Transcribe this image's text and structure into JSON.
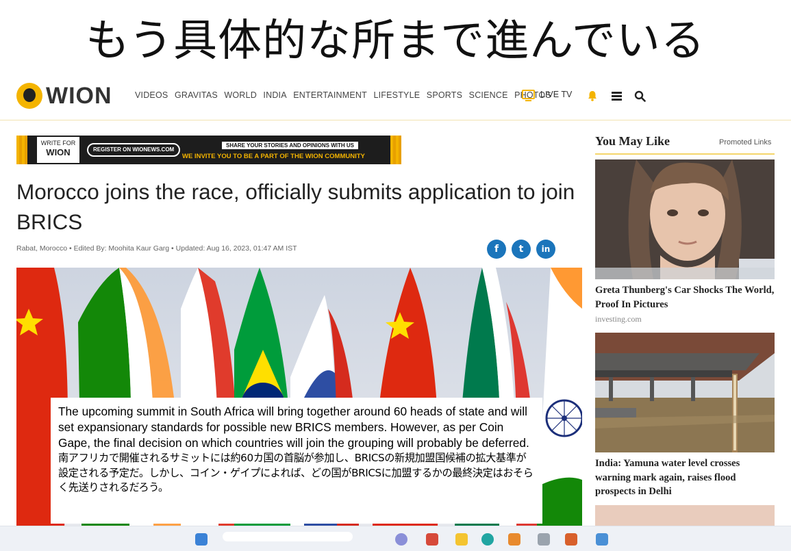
{
  "slide": {
    "title": "もう具体的な所まで進んでいる"
  },
  "header": {
    "logo_text": "WION",
    "nav": [
      "VIDEOS",
      "GRAVITAS",
      "WORLD",
      "INDIA",
      "ENTERTAINMENT",
      "LIFESTYLE",
      "SPORTS",
      "SCIENCE",
      "PHOTOS"
    ],
    "live_tv": "LIVE TV",
    "accent": "#f4b400"
  },
  "banner": {
    "write_for": "WRITE FOR",
    "wion": "WION",
    "register": "REGISTER ON WIONEWS.COM",
    "share": "SHARE YOUR STORIES AND OPINIONS WITH US",
    "invite": "WE INVITE YOU TO BE A PART OF THE WION COMMUNITY"
  },
  "article": {
    "headline": "Morocco joins the race, officially submits application to join BRICS",
    "location": "Rabat, Morocco",
    "edited_by": "Edited By: Moohita Kaur Garg",
    "updated": "Updated: Aug 16, 2023, 01:47 AM IST",
    "share_buttons": [
      "f",
      "t",
      "in"
    ]
  },
  "overlay": {
    "english": "The upcoming summit in South Africa will bring together around 60 heads of state and will set expansionary standards for possible new BRICS members. However, as per Coin Gape, the final decision on which countries will join the grouping will probably be deferred.",
    "japanese": "南アフリカで開催されるサミットには約60カ国の首脳が参加し、BRICSの新規加盟国候補の拡大基準が設定される予定だ。しかし、コイン・ゲイプによれば、どの国がBRICSに加盟するかの最終決定はおそらく先送りされるだろう。"
  },
  "sidebar": {
    "title": "You May Like",
    "promoted": "Promoted Links",
    "cards": [
      {
        "title": "Greta Thunberg's Car Shocks The World, Proof In Pictures",
        "source": "investing.com"
      },
      {
        "title": "India: Yamuna water level crosses warning mark again, raises flood prospects in Delhi",
        "source": ""
      }
    ]
  }
}
